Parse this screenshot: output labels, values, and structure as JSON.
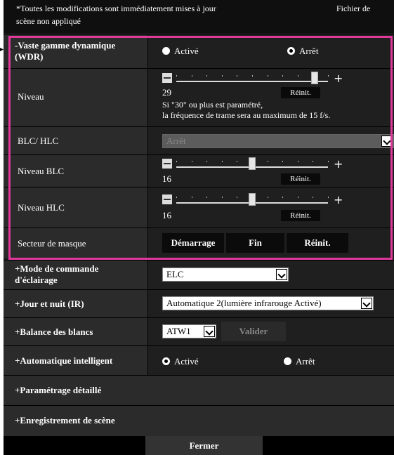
{
  "notice": {
    "line1": "*Toutes les modifications sont immédiatement mises à jour",
    "line1_right": "Fichier de",
    "line2": "scène non appliqué"
  },
  "wdr": {
    "label": "-Vaste gamme dynamique (WDR)",
    "options": [
      "Activé",
      "Arrêt"
    ],
    "selected": "Arrêt"
  },
  "niveau": {
    "label": "Niveau",
    "value": "29",
    "level_fraction": 0.93,
    "reset": "Réinit.",
    "note1": "Si \"30\" ou plus est paramétré,",
    "note2": "la fréquence de trame sera au maximum de 15 f/s."
  },
  "blc_hlc": {
    "label": "BLC/ HLC",
    "value": "Arrêt"
  },
  "niveau_blc": {
    "label": "Niveau BLC",
    "value": "16",
    "level_fraction": 0.5,
    "reset": "Réinit."
  },
  "niveau_hlc": {
    "label": "Niveau HLC",
    "value": "16",
    "level_fraction": 0.5,
    "reset": "Réinit."
  },
  "secteur": {
    "label": "Secteur de masque",
    "start": "Démarrage",
    "end": "Fin",
    "reset": "Réinit."
  },
  "eclairage": {
    "label": "+Mode de commande d'éclairage",
    "value": "ELC"
  },
  "jour_nuit": {
    "label": "+Jour et nuit (IR)",
    "value": "Automatique 2(lumière infrarouge Activé)"
  },
  "balance": {
    "label": "+Balance des blancs",
    "value": "ATW1",
    "apply": "Valider"
  },
  "auto_intel": {
    "label": "+Automatique intelligent",
    "options": [
      "Activé",
      "Arrêt"
    ],
    "selected": "Activé"
  },
  "detail": {
    "label": "+Paramétrage détaillé"
  },
  "scene": {
    "label": "+Enregistrement de scène"
  },
  "footer": {
    "close": "Fermer"
  },
  "colors": {
    "highlight": "#e0389a",
    "panel": "#1c1c1c"
  }
}
